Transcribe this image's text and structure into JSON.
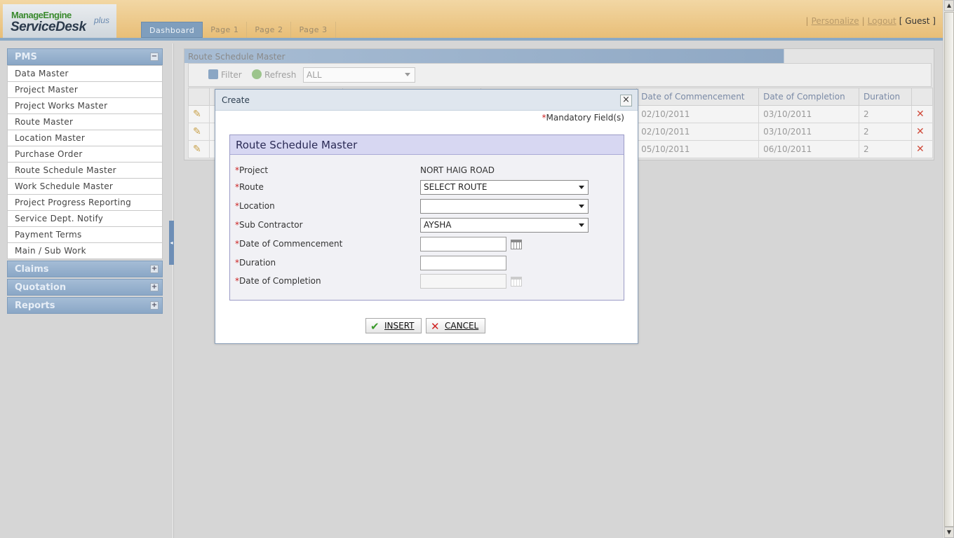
{
  "header": {
    "logo_top": "ManageEngine",
    "logo_main": "ServiceDesk",
    "logo_plus": "plus",
    "tabs": [
      "Dashboard",
      "Page 1",
      "Page 2",
      "Page 3"
    ],
    "personalize": "Personalize",
    "logout": "Logout",
    "user": "[ Guest ]"
  },
  "sidebar": {
    "pms": "PMS",
    "items": [
      "Data Master",
      "Project Master",
      "Project Works Master",
      "Route Master",
      "Location Master",
      "Purchase Order",
      "Route Schedule Master",
      "Work Schedule Master",
      "Project Progress Reporting",
      "Service Dept. Notify",
      "Payment Terms",
      "Main / Sub Work"
    ],
    "sections": [
      "Claims",
      "Quotation",
      "Reports"
    ]
  },
  "panel": {
    "title": "Route Schedule Master",
    "filter": "Filter",
    "refresh": "Refresh",
    "filter_value": "ALL",
    "columns": [
      "Date of Commencement",
      "Date of Completion",
      "Duration"
    ],
    "rows": [
      {
        "commencement": "02/10/2011",
        "completion": "03/10/2011",
        "duration": "2"
      },
      {
        "commencement": "02/10/2011",
        "completion": "03/10/2011",
        "duration": "2"
      },
      {
        "commencement": "05/10/2011",
        "completion": "06/10/2011",
        "duration": "2"
      }
    ]
  },
  "modal": {
    "title": "Create",
    "mandatory": "Mandatory Field(s)",
    "form_title": "Route Schedule Master",
    "labels": {
      "project": "Project",
      "route": "Route",
      "location": "Location",
      "sub_contractor": "Sub Contractor",
      "commencement": "Date of Commencement",
      "duration": "Duration",
      "completion": "Date of Completion"
    },
    "values": {
      "project": "NORT HAIG ROAD",
      "route": "SELECT ROUTE",
      "location": "",
      "sub_contractor": "AYSHA",
      "commencement": "",
      "duration": "",
      "completion": ""
    },
    "insert": "INSERT",
    "cancel": "CANCEL"
  }
}
